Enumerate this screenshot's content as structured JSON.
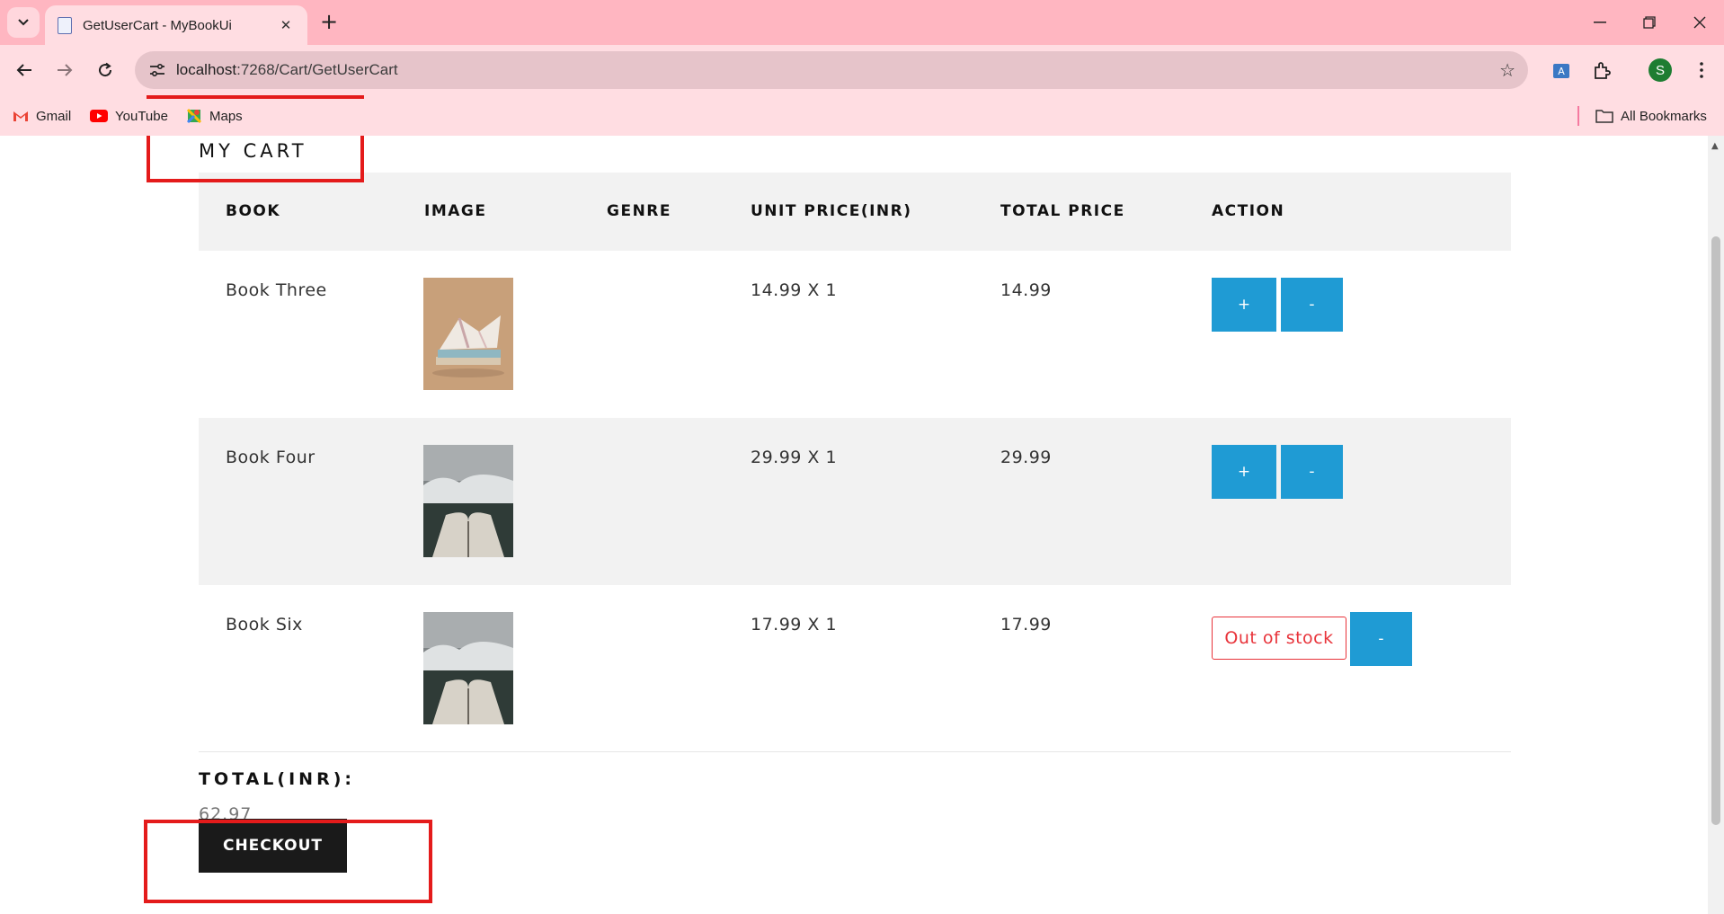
{
  "browser": {
    "tab_title": "GetUserCart - MyBookUi",
    "url_host": "localhost",
    "url_path": ":7268/Cart/GetUserCart",
    "profile_initial": "S",
    "bookmarks": [
      "Gmail",
      "YouTube",
      "Maps"
    ],
    "all_bookmarks_label": "All Bookmarks"
  },
  "page": {
    "heading": "MY CART",
    "columns": [
      "BOOK",
      "IMAGE",
      "GENRE",
      "UNIT PRICE(INR)",
      "TOTAL PRICE",
      "ACTION"
    ],
    "rows": [
      {
        "book": "Book Three",
        "image": "open-books-photo",
        "genre": "",
        "unit_price": "14.99 X 1",
        "total_price": "14.99",
        "plus": "+",
        "minus": "-",
        "out_of_stock": ""
      },
      {
        "book": "Book Four",
        "image": "book-mountain-photo",
        "genre": "",
        "unit_price": "29.99 X 1",
        "total_price": "29.99",
        "plus": "+",
        "minus": "-",
        "out_of_stock": ""
      },
      {
        "book": "Book Six",
        "image": "book-mountain-photo",
        "genre": "",
        "unit_price": "17.99 X 1",
        "total_price": "17.99",
        "plus": "",
        "minus": "-",
        "out_of_stock": "Out of stock"
      }
    ],
    "total_label": "TOTAL(INR):",
    "total_value": "62.97",
    "checkout_label": "CHECKOUT"
  },
  "colors": {
    "chrome": "#ffb6c1",
    "accent_button": "#1f9bd4",
    "out_of_stock": "#e8333a",
    "highlight_box": "#e41b1b"
  }
}
